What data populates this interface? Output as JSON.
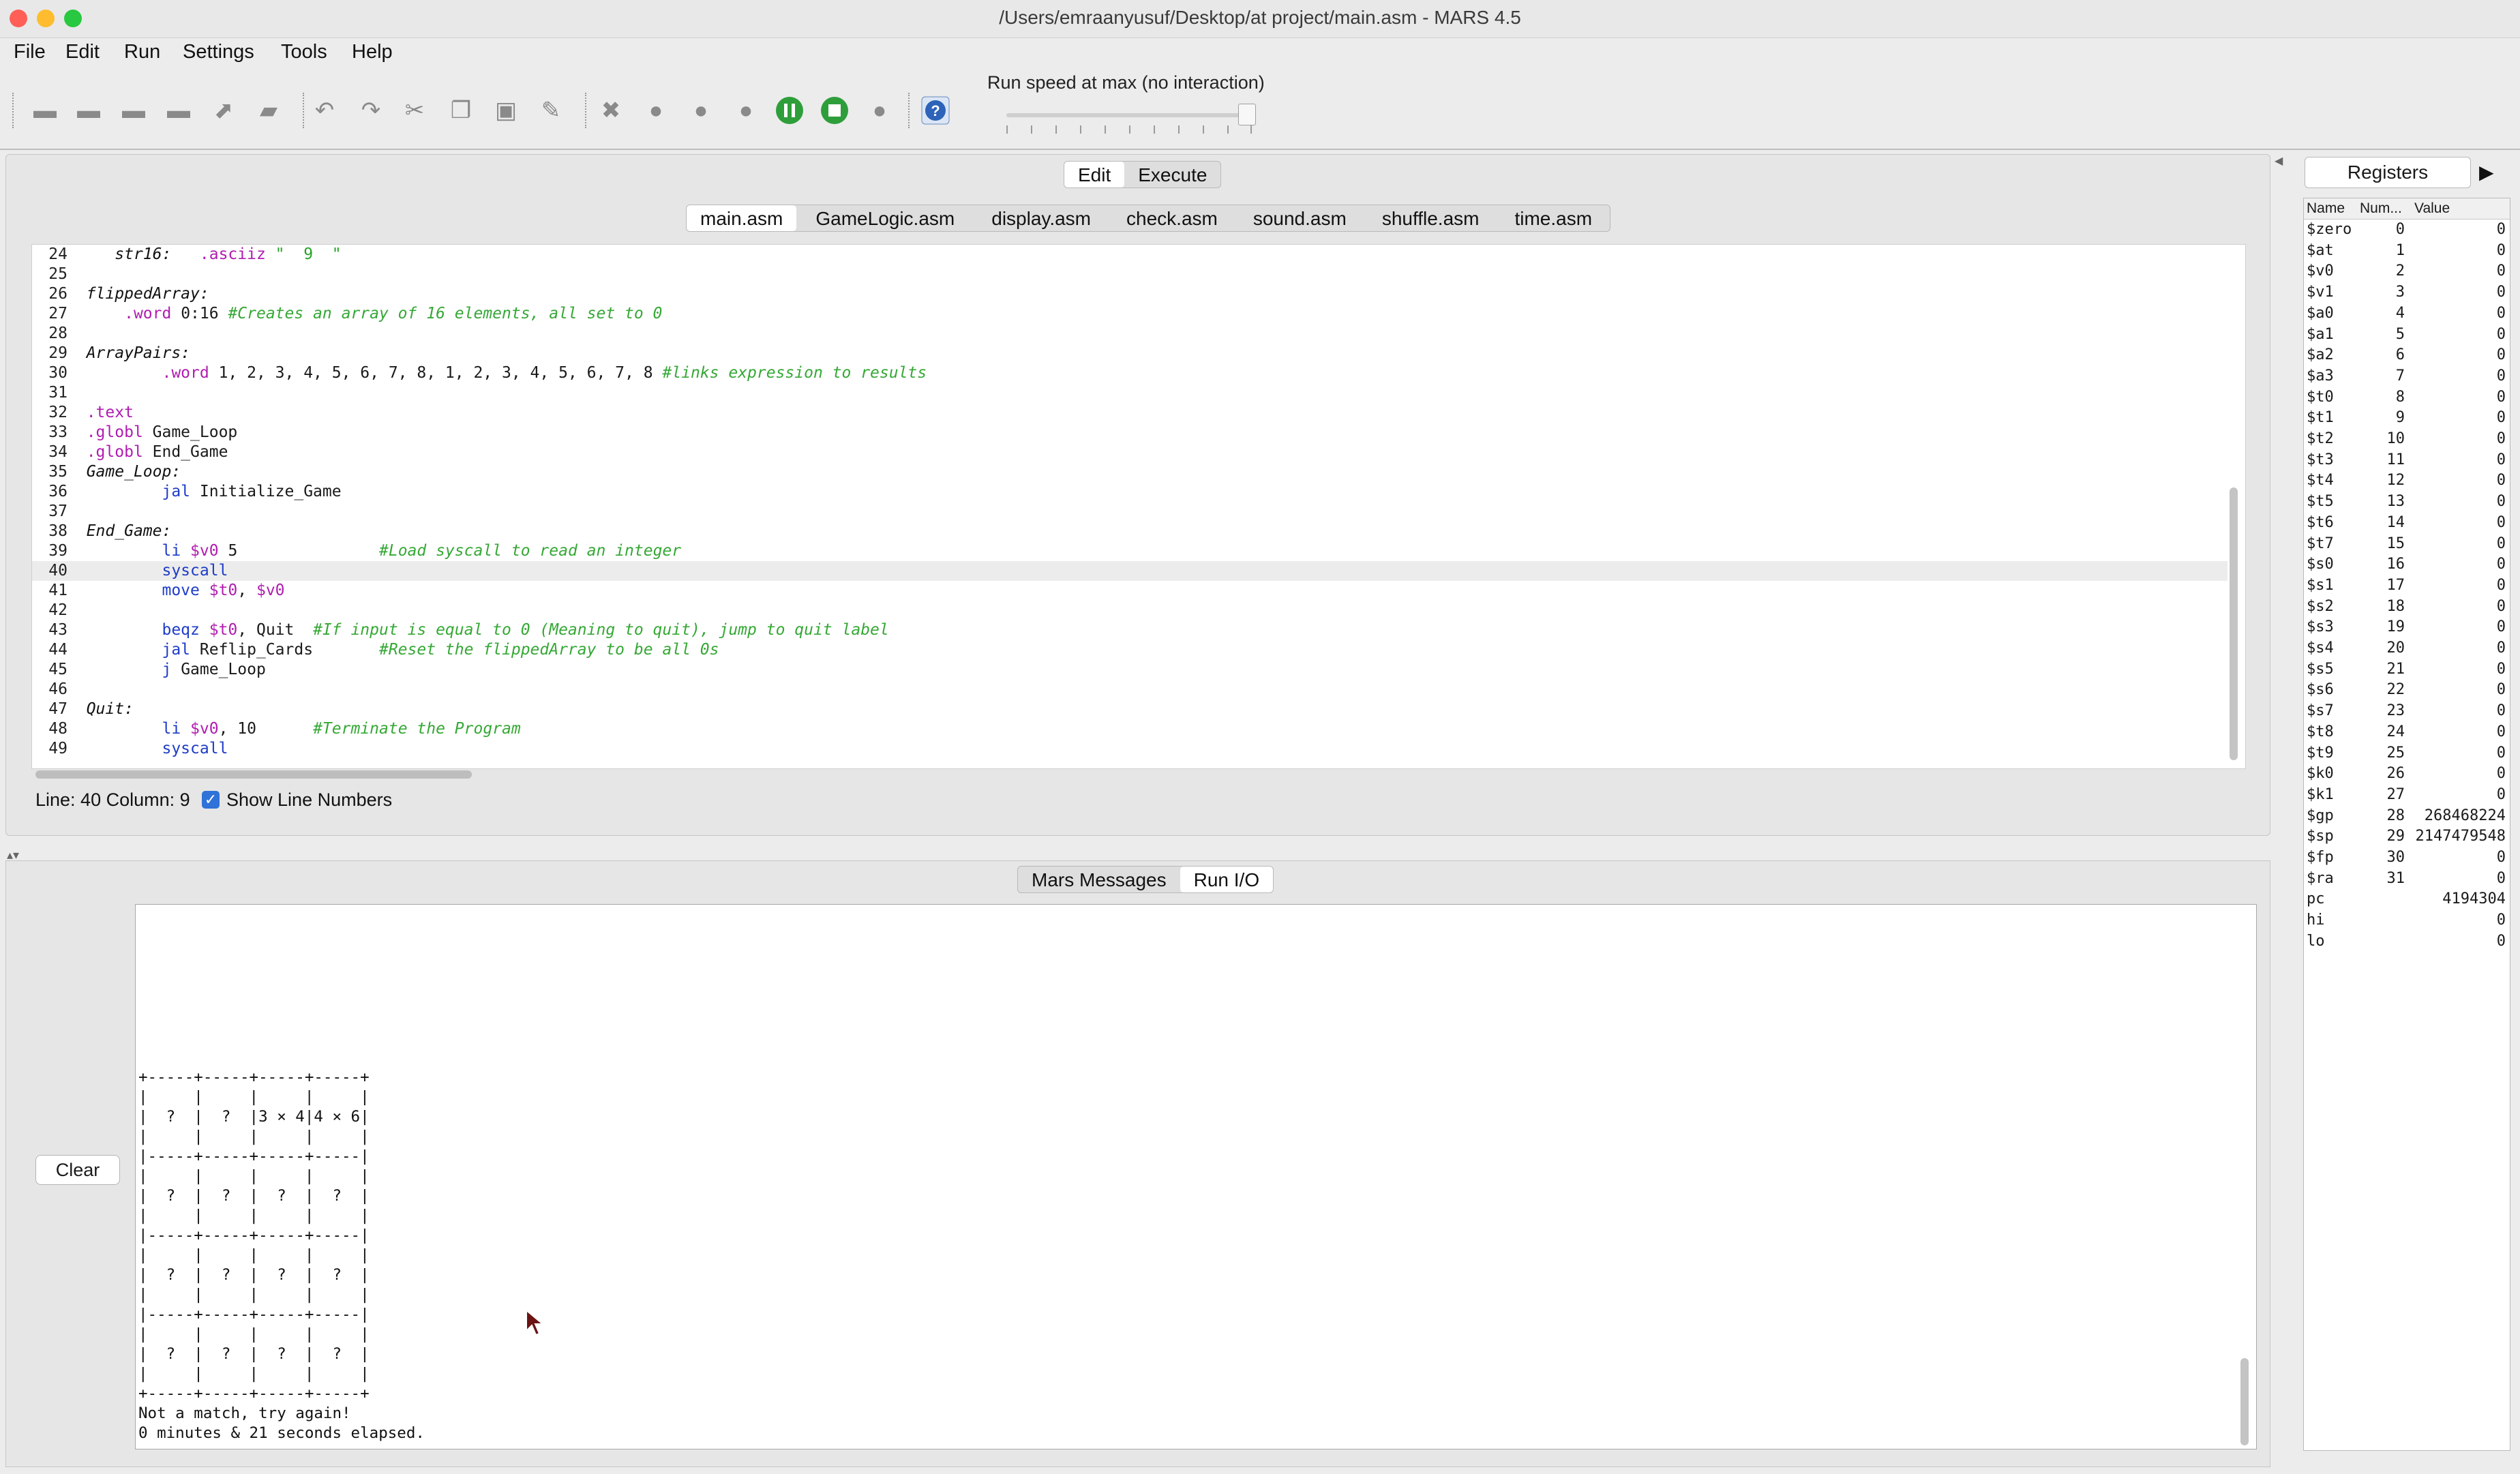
{
  "window": {
    "title": "/Users/emraanyusuf/Desktop/at project/main.asm  - MARS 4.5",
    "traffic_lights": [
      "#ff5f57",
      "#febc2e",
      "#28c840"
    ]
  },
  "menu": [
    "File",
    "Edit",
    "Run",
    "Settings",
    "Tools",
    "Help"
  ],
  "toolbar": {
    "buttons": [
      "new-file-icon",
      "open-file-icon",
      "close-file-icon",
      "save-icon",
      "dump-memory-icon",
      "print-icon",
      "undo-icon",
      "redo-icon",
      "cut-icon",
      "copy-icon",
      "paste-icon",
      "find-replace-icon",
      "assemble-icon",
      "run-icon",
      "step-icon",
      "backstep-icon",
      "pause-icon",
      "stop-icon",
      "reset-icon",
      "help-icon"
    ],
    "speed_label": "Run speed at max (no interaction)",
    "speed_level": 1.0
  },
  "mode_tabs": [
    "Edit",
    "Execute"
  ],
  "active_mode": "Edit",
  "file_tabs": [
    "main.asm",
    "GameLogic.asm",
    "display.asm",
    "check.asm",
    "sound.asm",
    "shuffle.asm",
    "time.asm"
  ],
  "active_file": "main.asm",
  "code_lines": [
    {
      "n": "24",
      "segs": [
        [
          "",
          "   "
        ],
        [
          "lbl",
          "str16:"
        ],
        [
          "",
          "   "
        ],
        [
          "dir",
          ".asciiz"
        ],
        [
          "str",
          " \"  9  \""
        ]
      ]
    },
    {
      "n": "25",
      "segs": []
    },
    {
      "n": "26",
      "segs": [
        [
          "lbl",
          "flippedArray:"
        ]
      ]
    },
    {
      "n": "27",
      "segs": [
        [
          "",
          "    "
        ],
        [
          "dir",
          ".word"
        ],
        [
          "",
          " 0:16 "
        ],
        [
          "cm",
          "#Creates an array of 16 elements, all set to 0"
        ]
      ]
    },
    {
      "n": "28",
      "segs": []
    },
    {
      "n": "29",
      "segs": [
        [
          "lbl",
          "ArrayPairs:"
        ]
      ]
    },
    {
      "n": "30",
      "segs": [
        [
          "",
          "        "
        ],
        [
          "dir",
          ".word"
        ],
        [
          "",
          " 1, 2, 3, 4, 5, 6, 7, 8, 1, 2, 3, 4, 5, 6, 7, 8 "
        ],
        [
          "cm",
          "#links expression to results"
        ]
      ]
    },
    {
      "n": "31",
      "segs": []
    },
    {
      "n": "32",
      "segs": [
        [
          "dir",
          ".text"
        ]
      ]
    },
    {
      "n": "33",
      "segs": [
        [
          "dir",
          ".globl"
        ],
        [
          "",
          " Game_Loop"
        ]
      ]
    },
    {
      "n": "34",
      "segs": [
        [
          "dir",
          ".globl"
        ],
        [
          "",
          " End_Game"
        ]
      ]
    },
    {
      "n": "35",
      "segs": [
        [
          "lbl",
          "Game_Loop:"
        ]
      ]
    },
    {
      "n": "36",
      "segs": [
        [
          "",
          "        "
        ],
        [
          "kw",
          "jal"
        ],
        [
          "",
          " Initialize_Game"
        ]
      ]
    },
    {
      "n": "37",
      "segs": []
    },
    {
      "n": "38",
      "segs": [
        [
          "lbl",
          "End_Game:"
        ]
      ]
    },
    {
      "n": "39",
      "segs": [
        [
          "",
          "        "
        ],
        [
          "kw",
          "li"
        ],
        [
          "",
          " "
        ],
        [
          "reg",
          "$v0"
        ],
        [
          "",
          " 5               "
        ],
        [
          "cm",
          "#Load syscall to read an integer"
        ]
      ]
    },
    {
      "n": "40",
      "segs": [
        [
          "",
          "        "
        ],
        [
          "kw",
          "syscall"
        ]
      ],
      "current": true
    },
    {
      "n": "41",
      "segs": [
        [
          "",
          "        "
        ],
        [
          "kw",
          "move"
        ],
        [
          "",
          " "
        ],
        [
          "reg",
          "$t0"
        ],
        [
          "",
          ", "
        ],
        [
          "reg",
          "$v0"
        ]
      ]
    },
    {
      "n": "42",
      "segs": []
    },
    {
      "n": "43",
      "segs": [
        [
          "",
          "        "
        ],
        [
          "kw",
          "beqz"
        ],
        [
          "",
          " "
        ],
        [
          "reg",
          "$t0"
        ],
        [
          "",
          ", Quit  "
        ],
        [
          "cm",
          "#If input is equal to 0 (Meaning to quit), jump to quit label"
        ]
      ]
    },
    {
      "n": "44",
      "segs": [
        [
          "",
          "        "
        ],
        [
          "kw",
          "jal"
        ],
        [
          "",
          " Reflip_Cards       "
        ],
        [
          "cm",
          "#Reset the flippedArray to be all 0s"
        ]
      ]
    },
    {
      "n": "45",
      "segs": [
        [
          "",
          "        "
        ],
        [
          "kw",
          "j"
        ],
        [
          "",
          " Game_Loop"
        ]
      ]
    },
    {
      "n": "46",
      "segs": []
    },
    {
      "n": "47",
      "segs": [
        [
          "lbl",
          "Quit:"
        ]
      ]
    },
    {
      "n": "48",
      "segs": [
        [
          "",
          "        "
        ],
        [
          "kw",
          "li"
        ],
        [
          "",
          " "
        ],
        [
          "reg",
          "$v0"
        ],
        [
          "",
          ", 10      "
        ],
        [
          "cm",
          "#Terminate the Program"
        ]
      ]
    },
    {
      "n": "49",
      "segs": [
        [
          "",
          "        "
        ],
        [
          "kw",
          "syscall"
        ]
      ]
    }
  ],
  "status": {
    "line_col": "Line: 40 Column: 9",
    "show_line_numbers_label": "Show Line Numbers",
    "show_line_numbers": true
  },
  "message_tabs": [
    "Mars Messages",
    "Run I/O"
  ],
  "active_message_tab": "Run I/O",
  "clear_label": "Clear",
  "run_io": "+-----+-----+-----+-----+\n|     |     |     |     |\n|  ?  |  ?  |3 × 4|4 × 6|\n|     |     |     |     |\n|-----+-----+-----+-----|\n|     |     |     |     |\n|  ?  |  ?  |  ?  |  ?  |\n|     |     |     |     |\n|-----+-----+-----+-----|\n|     |     |     |     |\n|  ?  |  ?  |  ?  |  ?  |\n|     |     |     |     |\n|-----+-----+-----+-----|\n|     |     |     |     |\n|  ?  |  ?  |  ?  |  ?  |\n|     |     |     |     |\n+-----+-----+-----+-----+\nNot a match, try again!\n0 minutes & 21 seconds elapsed.",
  "registers": {
    "tab_label": "Registers",
    "headers": [
      "Name",
      "Num...",
      "Value"
    ],
    "rows": [
      [
        "$zero",
        "0",
        "0"
      ],
      [
        "$at",
        "1",
        "0"
      ],
      [
        "$v0",
        "2",
        "0"
      ],
      [
        "$v1",
        "3",
        "0"
      ],
      [
        "$a0",
        "4",
        "0"
      ],
      [
        "$a1",
        "5",
        "0"
      ],
      [
        "$a2",
        "6",
        "0"
      ],
      [
        "$a3",
        "7",
        "0"
      ],
      [
        "$t0",
        "8",
        "0"
      ],
      [
        "$t1",
        "9",
        "0"
      ],
      [
        "$t2",
        "10",
        "0"
      ],
      [
        "$t3",
        "11",
        "0"
      ],
      [
        "$t4",
        "12",
        "0"
      ],
      [
        "$t5",
        "13",
        "0"
      ],
      [
        "$t6",
        "14",
        "0"
      ],
      [
        "$t7",
        "15",
        "0"
      ],
      [
        "$s0",
        "16",
        "0"
      ],
      [
        "$s1",
        "17",
        "0"
      ],
      [
        "$s2",
        "18",
        "0"
      ],
      [
        "$s3",
        "19",
        "0"
      ],
      [
        "$s4",
        "20",
        "0"
      ],
      [
        "$s5",
        "21",
        "0"
      ],
      [
        "$s6",
        "22",
        "0"
      ],
      [
        "$s7",
        "23",
        "0"
      ],
      [
        "$t8",
        "24",
        "0"
      ],
      [
        "$t9",
        "25",
        "0"
      ],
      [
        "$k0",
        "26",
        "0"
      ],
      [
        "$k1",
        "27",
        "0"
      ],
      [
        "$gp",
        "28",
        "268468224"
      ],
      [
        "$sp",
        "29",
        "2147479548"
      ],
      [
        "$fp",
        "30",
        "0"
      ],
      [
        "$ra",
        "31",
        "0"
      ],
      [
        "pc",
        "",
        "4194304"
      ],
      [
        "hi",
        "",
        "0"
      ],
      [
        "lo",
        "",
        "0"
      ]
    ]
  }
}
